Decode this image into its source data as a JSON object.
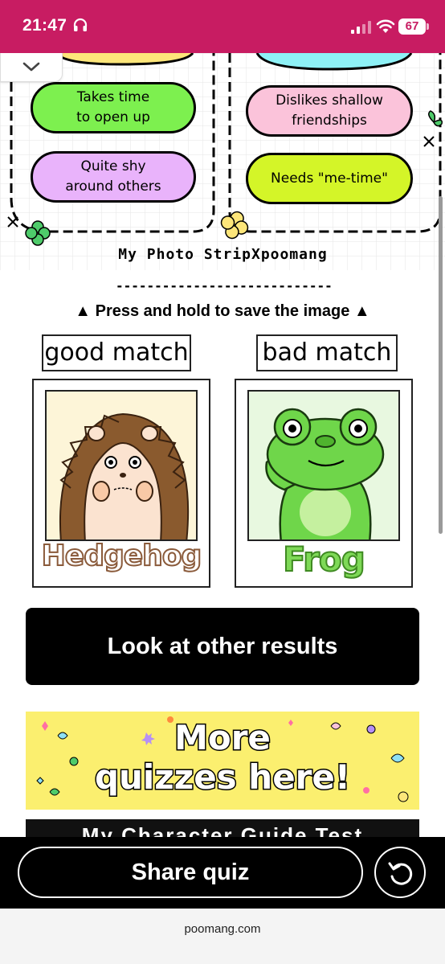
{
  "status_bar": {
    "time": "21:47",
    "battery": "67",
    "headphones_icon": "headphones-icon",
    "signal_icon": "cellular-signal-icon",
    "wifi_icon": "wifi-icon",
    "background": "#c81c62"
  },
  "strip": {
    "left_traits": [
      "Takes time\nto open up",
      "Quite shy\naround others"
    ],
    "right_traits": [
      "Dislikes shallow\nfriendships",
      "Needs \"me-time\""
    ],
    "bubble_colors": {
      "green": "#7df04f",
      "purple": "#e9b3fb",
      "pink": "#fbc3da",
      "lime": "#d4f528",
      "cyan_partial": "#8ef1f6",
      "yellow_partial": "#fde67a"
    },
    "title": "My Photo StripXpoomang",
    "dashes": "----------------------------"
  },
  "save_hint": "▲ Press and hold to save the image ▲",
  "matches": {
    "good": {
      "label": "good match",
      "animal": "Hedgehog",
      "photo_bg": "#fdf5d8",
      "name_color": "#8a5a3a"
    },
    "bad": {
      "label": "bad match",
      "animal": "Frog",
      "photo_bg": "#e8f8e0",
      "name_color": "#7ed957"
    }
  },
  "buttons": {
    "other_results": "Look at other results",
    "share": "Share quiz",
    "refresh_icon": "refresh-icon",
    "collapse_icon": "chevron-down-icon"
  },
  "banner": {
    "line1": "More",
    "line2": "quizzes here!",
    "next_banner_partial": "My Character Guide Test",
    "background": "#fbef6f"
  },
  "url": "poomang.com"
}
